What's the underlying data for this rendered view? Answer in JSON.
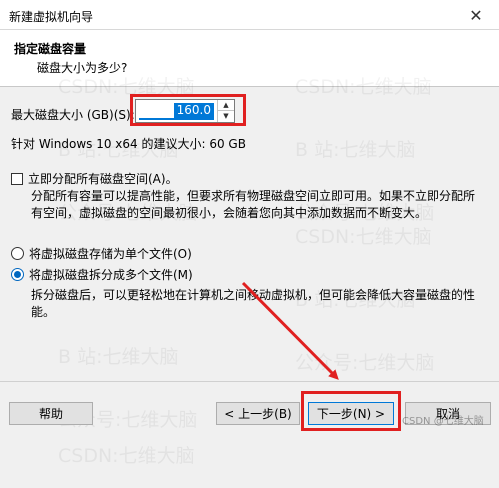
{
  "window": {
    "title": "新建虚拟机向导",
    "close_glyph": "✕"
  },
  "header": {
    "title": "指定磁盘容量",
    "subtitle": "磁盘大小为多少?"
  },
  "watermark": {
    "lines": [
      "CSDN:七维大脑",
      "B 站:七维大脑",
      "公众号:七维大脑"
    ],
    "corner": "CSDN @七维大脑"
  },
  "disk": {
    "max_label": "最大磁盘大小 (GB)(S):",
    "value": "160.0",
    "spin_up": "▲",
    "spin_down": "▼",
    "recommend": "针对 Windows 10 x64 的建议大小: 60 GB"
  },
  "allocate": {
    "label": "立即分配所有磁盘空间(A)。",
    "checked": false,
    "description": "分配所有容量可以提高性能，但要求所有物理磁盘空间立即可用。如果不立即分配所有空间，虚拟磁盘的空间最初很小，会随着您向其中添加数据而不断变大。"
  },
  "storage": {
    "single_label": "将虚拟磁盘存储为单个文件(O)",
    "multi_label": "将虚拟磁盘拆分成多个文件(M)",
    "selected": "multi",
    "multi_description": "拆分磁盘后，可以更轻松地在计算机之间移动虚拟机，但可能会降低大容量磁盘的性能。"
  },
  "buttons": {
    "help": "帮助",
    "back": "< 上一步(B)",
    "next": "下一步(N) >",
    "cancel": "取消"
  },
  "colors": {
    "highlight_red": "#e02020",
    "accent_blue": "#0078d7"
  }
}
